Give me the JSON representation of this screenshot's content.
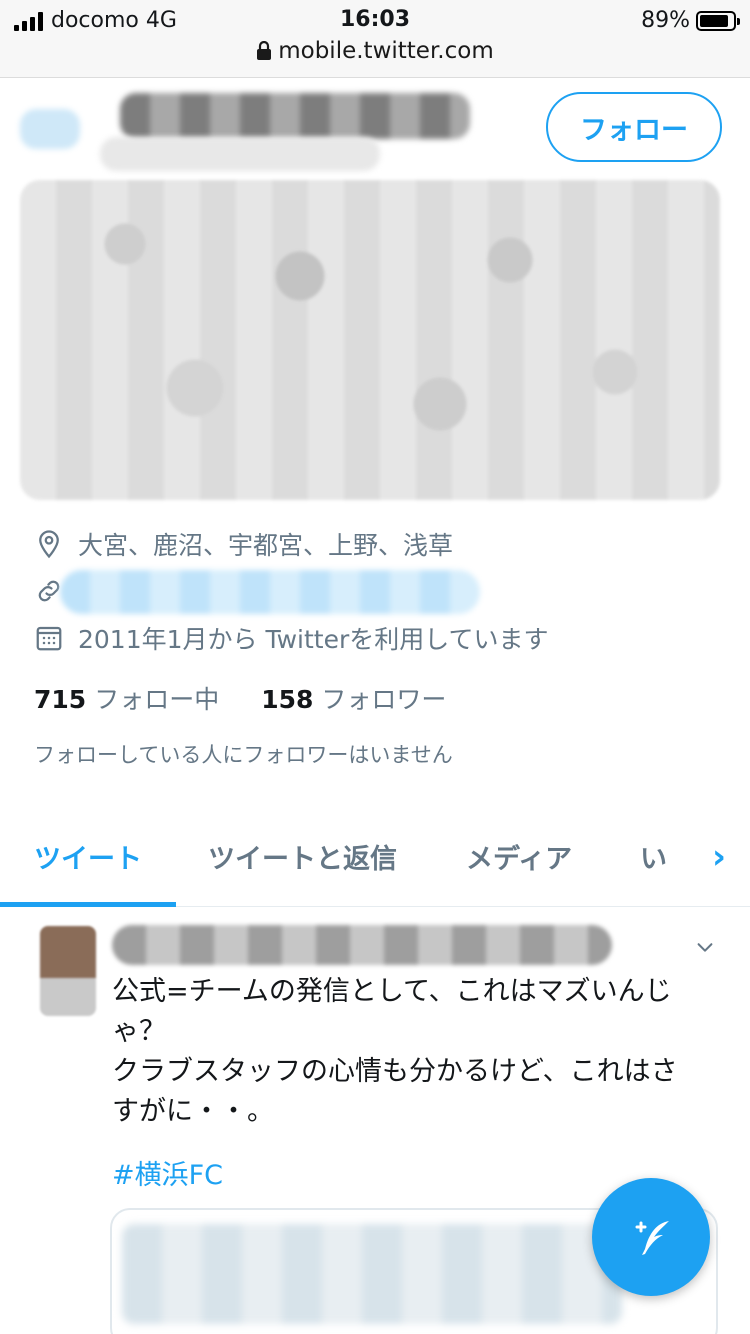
{
  "status_bar": {
    "carrier": "docomo",
    "network": "4G",
    "time": "16:03",
    "battery": "89%",
    "battery_level": 0.89
  },
  "browser": {
    "url": "mobile.twitter.com"
  },
  "profile": {
    "follow_button_label": "フォロー",
    "location": "大宮、鹿沼、宇都宮、上野、浅草",
    "joined": "2011年1月から Twitterを利用しています",
    "following_count": "715",
    "following_label": "フォロー中",
    "followers_count": "158",
    "followers_label": "フォロワー",
    "known_followers_notice": "フォローしている人にフォロワーはいません"
  },
  "tabs": [
    {
      "label": "ツイート"
    },
    {
      "label": "ツイートと返信"
    },
    {
      "label": "メディア"
    },
    {
      "label": "い"
    }
  ],
  "tweet": {
    "text_lines": [
      "公式=チームの発信として、これはマズいんじ",
      "ゃ？",
      "クラブスタッフの心情も分かるけど、これはさ",
      "すがに・・。"
    ],
    "hashtag": "#横浜FC"
  },
  "colors": {
    "accent": "#1da1f2",
    "secondary_text": "#657786"
  },
  "icons": {
    "location": "map-pin-icon",
    "link": "link-icon",
    "calendar": "calendar-icon",
    "lock": "lock-icon",
    "compose": "compose-tweet-icon",
    "caret": "chevron-down-icon"
  }
}
